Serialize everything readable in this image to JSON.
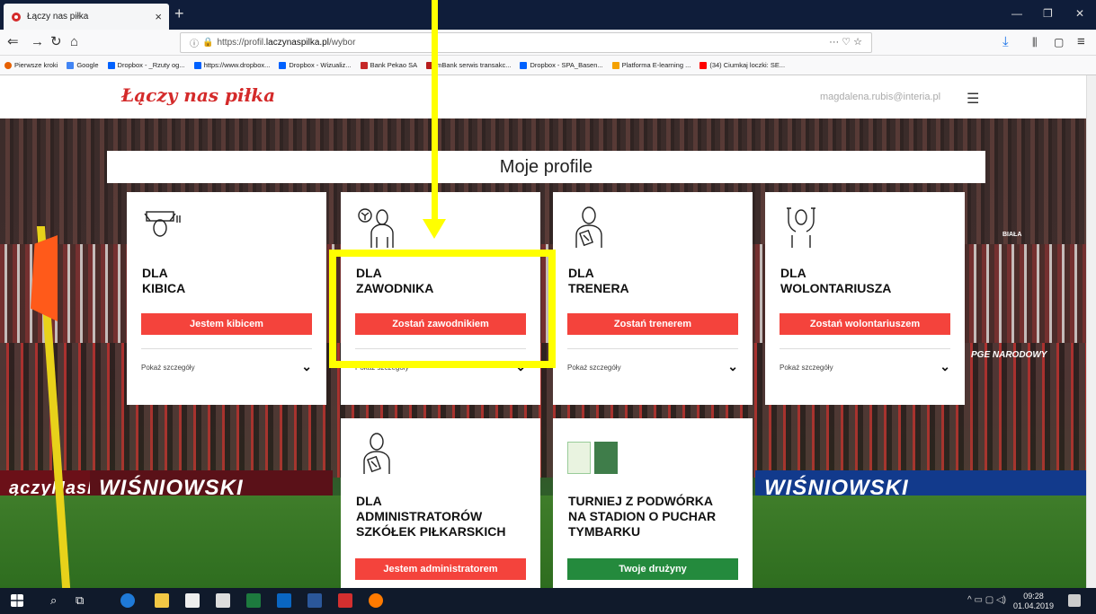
{
  "browser": {
    "tab_title": "Łączy nas piłka",
    "tab_close": "×",
    "new_tab": "+",
    "url_prefix": "https://profil.",
    "url_domain": "laczynaspilka.pl",
    "url_path": "/wybor",
    "url_actions": "··· ♡ ☆",
    "bookmarks": [
      "Pierwsze kroki",
      "Google",
      "Dropbox - _Rzuty og...",
      "https://www.dropbox...",
      "Dropbox - Wizualiz...",
      "Bank Pekao SA",
      "mBank serwis transakc...",
      "Dropbox - SPA_Basen...",
      "Platforma E-learning ...",
      "(34) Ciumkaj loczki: SE..."
    ]
  },
  "site": {
    "logo": "Łączy nas piłka",
    "user_email": "magdalena.rubis@interia.pl",
    "page_title": "Moje profile"
  },
  "cards": [
    {
      "title_line1": "DLA",
      "title_line2": "KIBICA",
      "button": "Jestem kibicem",
      "details": "Pokaż szczegóły"
    },
    {
      "title_line1": "DLA",
      "title_line2": "ZAWODNIKA",
      "button": "Zostań zawodnikiem",
      "details": "Pokaż szczegóły"
    },
    {
      "title_line1": "DLA",
      "title_line2": "TRENERA",
      "button": "Zostań trenerem",
      "details": "Pokaż szczegóły"
    },
    {
      "title_line1": "DLA",
      "title_line2": "WOLONTARIUSZA",
      "button": "Zostań wolontariuszem",
      "details": "Pokaż szczegóły"
    },
    {
      "title_line1": "DLA",
      "title_line2": "ADMINISTRATORÓW",
      "title_line3": "SZKÓŁEK PIŁKARSKICH",
      "button": "Jestem administratorem"
    },
    {
      "title_line1": "TURNIEJ Z PODWÓRKA",
      "title_line2": "NA STADION O PUCHAR",
      "title_line3": "TYMBARKU",
      "button": "Twoje drużyny"
    }
  ],
  "background": {
    "banner_left": "WIŚNIOWSKI",
    "banner_right": "WIŚNIOWSKI",
    "banner_far_left": "ączyNasPiłka",
    "board_right": "PGE NARODOWY",
    "board_biala": "BIAŁA"
  },
  "taskbar": {
    "time": "09:28",
    "date": "01.04.2019"
  },
  "colors": {
    "accent_red": "#f4433c",
    "green": "#248a3d",
    "highlight": "#ffff00"
  }
}
